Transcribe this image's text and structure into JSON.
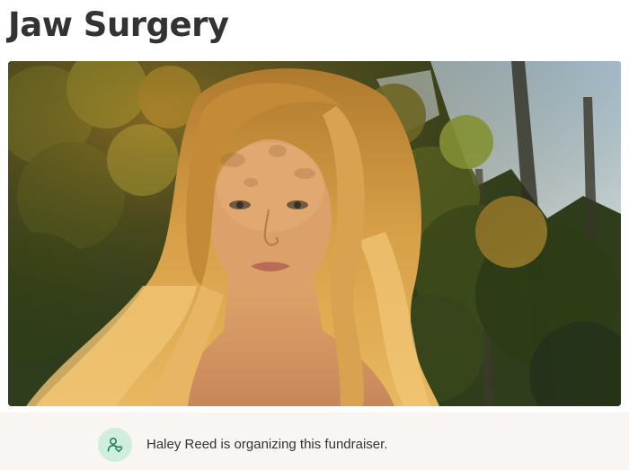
{
  "campaign": {
    "title": "Jaw Surgery"
  },
  "hero": {
    "image_alt": "woman-with-long-blonde-hair-in-forest"
  },
  "organizer": {
    "icon": "person-heart-icon",
    "text": "Haley Reed is organizing this fundraiser."
  },
  "colors": {
    "title_text": "#333333",
    "strip_background": "#f8f5f2",
    "icon_badge": "#cfeedd",
    "icon_stroke": "#1a7a4c"
  }
}
